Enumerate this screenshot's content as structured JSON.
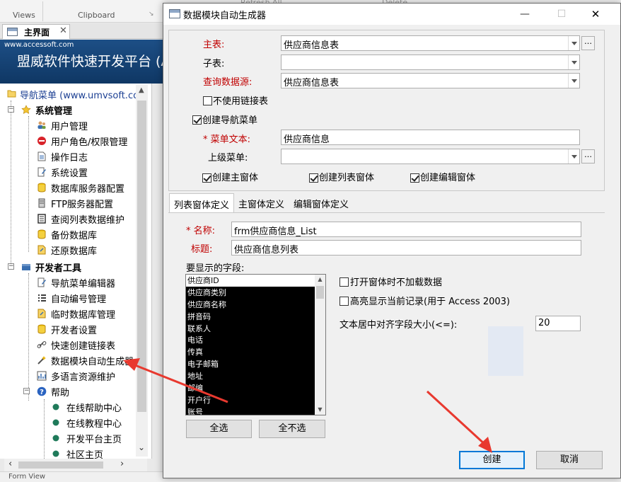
{
  "ribbon": {
    "group1": "Views",
    "group2": "Clipboard",
    "faded1": "Refresh All",
    "faded2": "Delete"
  },
  "doc_tab": {
    "label": "主界面"
  },
  "banner": {
    "site": "www.accessoft.com",
    "title": "盟威软件快速开发平台 (A"
  },
  "nav": {
    "root": "导航菜单 (www.umvsoft.co",
    "sys_group": "系统管理",
    "sys_items": [
      "用户管理",
      "用户角色/权限管理",
      "操作日志",
      "系统设置",
      "数据库服务器配置",
      "FTP服务器配置",
      "查阅列表数据维护",
      "备份数据库",
      "还原数据库"
    ],
    "dev_group": "开发者工具",
    "dev_items": [
      "导航菜单编辑器",
      "自动编号管理",
      "临时数据库管理",
      "开发者设置",
      "快速创建链接表",
      "数据模块自动生成器",
      "多语言资源维护"
    ],
    "help_group": "帮助",
    "help_items": [
      "在线帮助中心",
      "在线教程中心",
      "开发平台主页",
      "社区主页"
    ]
  },
  "status": {
    "text": "Form View"
  },
  "dialog": {
    "title": "数据模块自动生成器",
    "main_table_label": "主表:",
    "main_table_value": "供应商信息表",
    "sub_table_label": "子表:",
    "sub_table_value": "",
    "query_source_label": "查询数据源:",
    "query_source_value": "供应商信息表",
    "no_link_label": "不使用链接表",
    "create_nav_label": "创建导航菜单",
    "menu_text_label": "* 菜单文本:",
    "menu_text_value": "供应商信息",
    "parent_menu_label": "上级菜单:",
    "parent_menu_value": "",
    "create_main_label": "创建主窗体",
    "create_list_label": "创建列表窗体",
    "create_edit_label": "创建编辑窗体",
    "tabs": [
      "列表窗体定义",
      "主窗体定义",
      "编辑窗体定义"
    ],
    "name_label": "* 名称:",
    "name_value": "frm供应商信息_List",
    "caption_label": "标题:",
    "caption_value": "供应商信息列表",
    "fields_label": "要显示的字段:",
    "fields": [
      "供应商ID",
      "供应商类别",
      "供应商名称",
      "拼音码",
      "联系人",
      "电话",
      "传真",
      "电子邮箱",
      "地址",
      "邮编",
      "开户行",
      "账号"
    ],
    "select_all": "全选",
    "select_none": "全不选",
    "no_load_label": "打开窗体时不加载数据",
    "highlight_label": "高亮显示当前记录(用于 Access 2003)",
    "center_size_label": "文本居中对齐字段大小(<=):",
    "center_size_value": "20",
    "create_button": "创建",
    "cancel_button": "取消"
  },
  "colors": {
    "required_label": "#c00000",
    "annotation_arrow": "#e8392f",
    "banner": "#1d4f86"
  }
}
